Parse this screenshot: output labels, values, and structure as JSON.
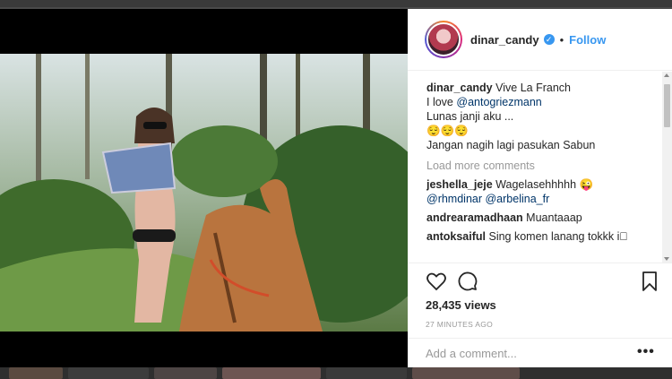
{
  "post": {
    "username": "dinar_candy",
    "follow_label": "Follow",
    "separator": "•",
    "verified_glyph": "✓"
  },
  "caption": {
    "username": "dinar_candy",
    "line1": "Vive La Franch",
    "line2_prefix": "I love",
    "line2_mention": "@antogriezmann",
    "line3": "Lunas janji aku ...",
    "line4": "😌😌😌",
    "line5": "Jangan nagih lagi pasukan Sabun"
  },
  "load_more_label": "Load more comments",
  "comments": [
    {
      "user": "jeshella_jeje",
      "text": "Wagelasehhhhh 😜",
      "mentions": "@rhmdinar @arbelina_fr"
    },
    {
      "user": "andrearamadhaan",
      "text": "Muantaaap"
    },
    {
      "user": "antoksaiful",
      "text": "Sing komen lanang tokkk i🏻"
    }
  ],
  "stats": {
    "views": "28,435 views",
    "time": "27 MINUTES AGO"
  },
  "composer": {
    "placeholder": "Add a comment...",
    "more_label": "•••"
  },
  "icons": {
    "like": "heart-icon",
    "comment": "comment-icon",
    "save": "bookmark-icon",
    "more": "more-options-icon"
  }
}
